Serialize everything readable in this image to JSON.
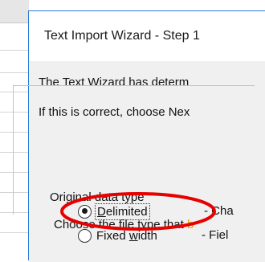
{
  "dialog": {
    "title": "Text Import Wizard - Step 1",
    "line1": "The Text Wizard has determ",
    "line2": "If this is correct, choose Nex",
    "group_label": "Original data type",
    "choose_prefix": "Choose the file type that ",
    "choose_hl": "b",
    "options": [
      {
        "label_first": "D",
        "label_rest": "elimited",
        "desc": "- Cha",
        "checked": true
      },
      {
        "label_first": "Fixed ",
        "label_rest": "w",
        "label_tail": "idth",
        "desc": "- Fiel",
        "checked": false
      }
    ]
  },
  "annotation": {
    "color": "#e60000"
  },
  "colors": {
    "dialog_border": "#2f7bd8",
    "body_bg": "#f0f0f0",
    "highlight_text": "#e8a000"
  }
}
